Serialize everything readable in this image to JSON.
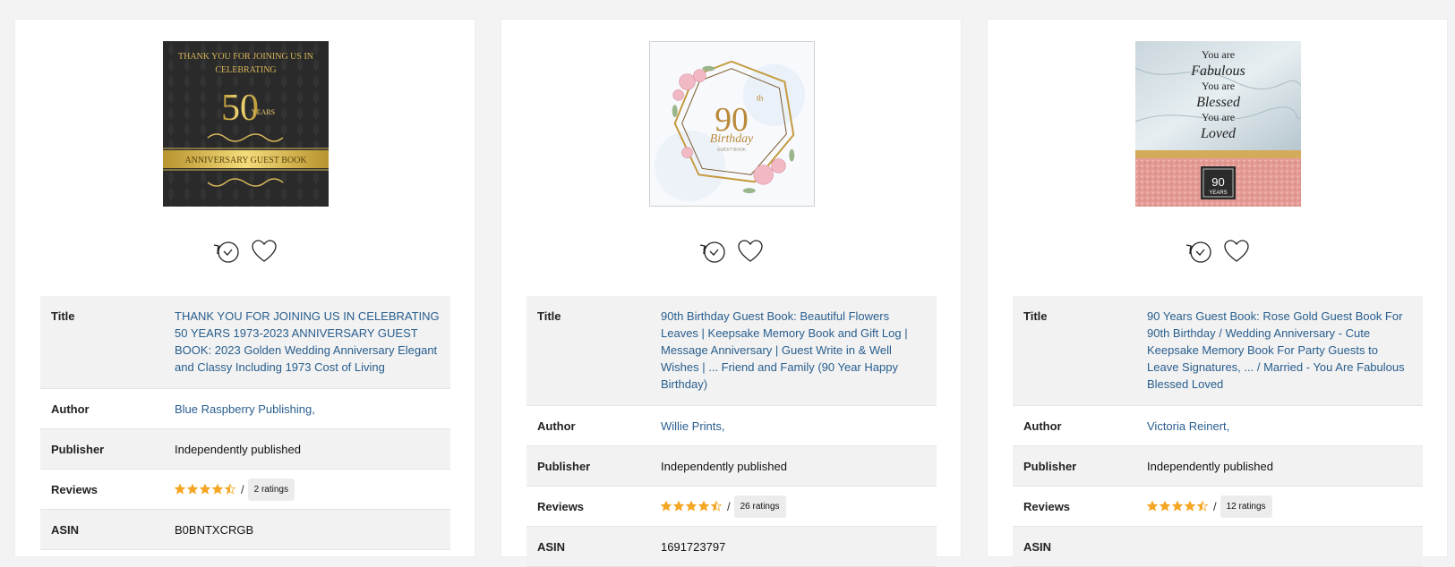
{
  "labels": {
    "title": "Title",
    "author": "Author",
    "publisher": "Publisher",
    "reviews": "Reviews",
    "asin": "ASIN"
  },
  "colors": {
    "accent_link": "#285e8e",
    "star": "#f5a623",
    "row_alt": "#f2f2f2"
  },
  "icons": [
    "history-clock-icon",
    "heart-icon",
    "star-icon",
    "half-star-icon"
  ],
  "books": [
    {
      "cover_text": {
        "line1": "THANK YOU FOR JOINING US IN",
        "line2": "CELEBRATING",
        "big": "50",
        "years": "YEARS",
        "band": "ANNIVERSARY GUEST BOOK"
      },
      "title": "THANK YOU FOR JOINING US IN CELEBRATING 50 YEARS 1973-2023 ANNIVERSARY GUEST BOOK: 2023 Golden Wedding Anniversary Elegant and Classy Including 1973 Cost of Living",
      "author": "Blue Raspberry Publishing,",
      "publisher": "Independently published",
      "rating": 4.5,
      "ratings_label": "2 ratings",
      "asin": "B0BNTXCRGB"
    },
    {
      "cover_text": {
        "big": "90",
        "sup": "th",
        "script": "Birthday",
        "small": "GUEST BOOK"
      },
      "title": "90th Birthday Guest Book: Beautiful Flowers Leaves | Keepsake Memory Book and Gift Log | Message Anniversary | Guest Write in & Well Wishes | ... Friend and Family (90 Year Happy Birthday)",
      "author": "Willie Prints,",
      "publisher": "Independently published",
      "rating": 4.5,
      "ratings_label": "26 ratings",
      "asin": "1691723797"
    },
    {
      "cover_text": {
        "l1": "You are",
        "l2": "Fabulous",
        "l3": "You are",
        "l4": "Blessed",
        "l5": "You are",
        "l6": "Loved",
        "badge_num": "90",
        "badge_word": "YEARS"
      },
      "title": "90 Years Guest Book: Rose Gold Guest Book For 90th Birthday / Wedding Anniversary - Cute Keepsake Memory Book For Party Guests to Leave Signatures, ... / Married - You Are Fabulous Blessed Loved",
      "author": "Victoria Reinert,",
      "publisher": "Independently published",
      "rating": 4.5,
      "ratings_label": "12 ratings",
      "asin": ""
    }
  ]
}
